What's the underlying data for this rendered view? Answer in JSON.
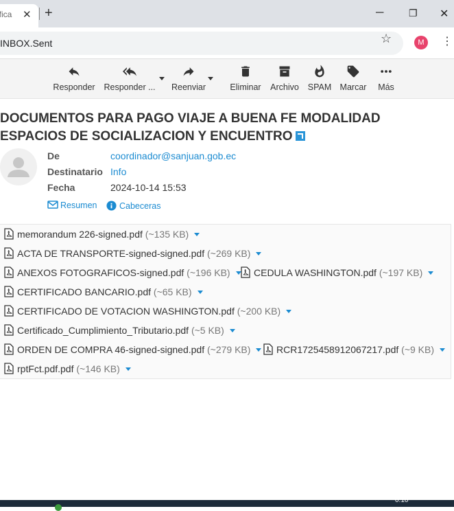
{
  "browser": {
    "tab_title": "ifica",
    "tab_close": "✕",
    "new_tab": "+",
    "minimize": "─",
    "restore": "❐",
    "close": "✕",
    "url": "INBOX.Sent",
    "profile_initial": "M",
    "profile_color": "#e8436c"
  },
  "toolbar": {
    "buttons": [
      {
        "label": "Responder",
        "icon": "reply-icon"
      },
      {
        "label": "Responder ...",
        "icon": "reply-all-icon"
      },
      {
        "label": "Reenviar",
        "icon": "forward-icon"
      },
      {
        "label": "Eliminar",
        "icon": "trash-icon"
      },
      {
        "label": "Archivo",
        "icon": "archive-icon"
      },
      {
        "label": "SPAM",
        "icon": "flame-icon"
      },
      {
        "label": "Marcar",
        "icon": "tag-icon"
      },
      {
        "label": "Más",
        "icon": "more-icon"
      }
    ]
  },
  "message": {
    "subject_line1": "DOCUMENTOS PARA PAGO VIAJE A BUENA FE MODALIDAD",
    "subject_line2": "ESPACIOS DE SOCIALIZACION Y ENCUENTRO",
    "from_label": "De",
    "from_value": "coordinador@sanjuan.gob.ec",
    "to_label": "Destinatario",
    "to_value": "Info",
    "date_label": "Fecha",
    "date_value": "2024-10-14 15:53",
    "summary_link": "Resumen",
    "headers_link": "Cabeceras"
  },
  "attachments": [
    {
      "name": "memorandum 226-signed.pdf",
      "size": "(~135 KB)"
    },
    {
      "name": "ACTA DE TRANSPORTE-signed-signed.pdf",
      "size": "(~269 KB)"
    },
    {
      "name": "ANEXOS FOTOGRAFICOS-signed.pdf",
      "size": "(~196 KB)"
    },
    {
      "name": "CEDULA WASHINGTON.pdf",
      "size": "(~197 KB)"
    },
    {
      "name": "CERTIFICADO BANCARIO.pdf",
      "size": "(~65 KB)"
    },
    {
      "name": "CERTIFICADO DE VOTACION WASHINGTON.pdf",
      "size": "(~200 KB)"
    },
    {
      "name": "Certificado_Cumplimiento_Tributario.pdf",
      "size": "(~5 KB)"
    },
    {
      "name": "ORDEN DE COMPRA 46-signed-signed.pdf",
      "size": "(~279 KB)"
    },
    {
      "name": "RCR1725458912067217.pdf",
      "size": "(~9 KB)"
    },
    {
      "name": "rptFct.pdf.pdf",
      "size": "(~146 KB)"
    }
  ],
  "taskbar": {
    "clock": "0:10"
  },
  "colors": {
    "accent": "#1b8bd1",
    "toolbar_bg": "#f4f4f4"
  }
}
